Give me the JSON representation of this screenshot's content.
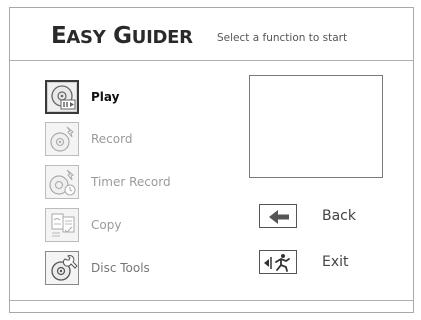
{
  "header": {
    "title_cap1": "E",
    "title_rest1": "ASY",
    "title_cap2": "G",
    "title_rest2": "UIDER",
    "subtitle": "Select a function to start"
  },
  "menu": {
    "items": [
      {
        "label": "Play",
        "icon": "disc-play-icon",
        "selected": true
      },
      {
        "label": "Record",
        "icon": "disc-record-icon",
        "selected": false
      },
      {
        "label": "Timer Record",
        "icon": "disc-timer-record-icon",
        "selected": false
      },
      {
        "label": "Copy",
        "icon": "copy-documents-icon",
        "selected": false
      },
      {
        "label": "Disc Tools",
        "icon": "disc-tools-icon",
        "selected": false
      }
    ]
  },
  "nav": {
    "back_label": "Back",
    "exit_label": "Exit"
  },
  "colors": {
    "frame_border": "#a8a8a8",
    "selected_text": "#111111",
    "disabled_text": "#9a9a9a"
  }
}
